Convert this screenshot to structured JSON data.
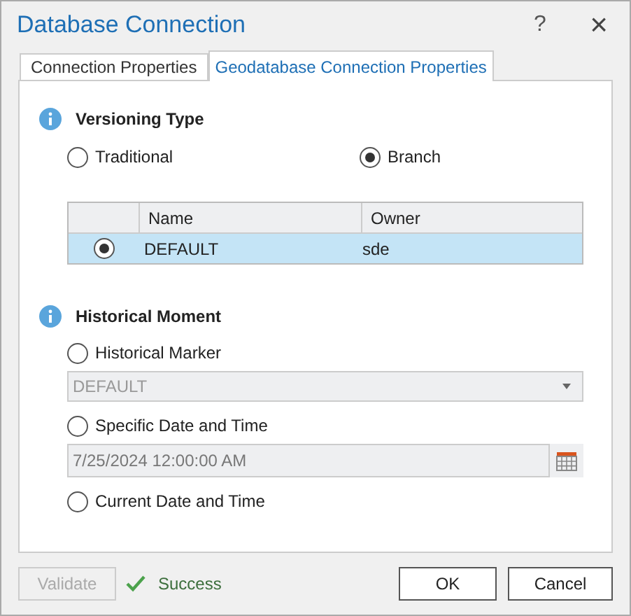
{
  "window": {
    "title": "Database Connection",
    "help": "?",
    "close": "×"
  },
  "tabs": [
    {
      "label": "Connection Properties",
      "selected": false
    },
    {
      "label": "Geodatabase Connection Properties",
      "selected": true
    }
  ],
  "versioning": {
    "title": "Versioning Type",
    "options": [
      {
        "label": "Traditional",
        "selected": false
      },
      {
        "label": "Branch",
        "selected": true
      }
    ],
    "table": {
      "columns": [
        "Name",
        "Owner"
      ],
      "rows": [
        {
          "name": "DEFAULT",
          "owner": "sde",
          "selected": true
        }
      ]
    }
  },
  "historical": {
    "title": "Historical Moment",
    "options": [
      {
        "kind": "dropdown",
        "label": "Historical Marker",
        "selected": false,
        "value": "DEFAULT",
        "disabled": true
      },
      {
        "kind": "date",
        "label": "Specific Date and Time",
        "selected": false,
        "value": "7/25/2024 12:00:00 AM",
        "disabled": true
      },
      {
        "kind": "plain",
        "label": "Current Date and Time",
        "selected": false
      }
    ]
  },
  "footer": {
    "validate": {
      "label": "Validate",
      "disabled": true
    },
    "status": "Success",
    "buttons": [
      "OK",
      "Cancel"
    ]
  }
}
